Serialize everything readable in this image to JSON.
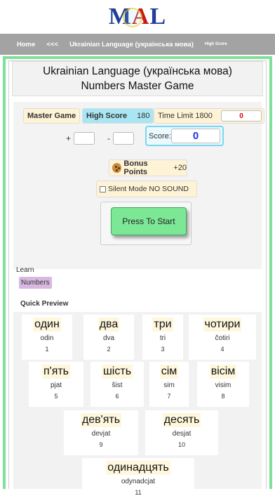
{
  "logo": {
    "m": "M",
    "a": "A",
    "l": "L"
  },
  "nav": {
    "home": "Home",
    "back": "<<<",
    "title": "Ukrainian Language (українська мова)",
    "high_score": "High Score"
  },
  "game": {
    "title_line1": "Ukrainian Language (українська мова)",
    "title_line2": "Numbers Master Game"
  },
  "controls": {
    "master_game": "Master Game",
    "high_score_label": "High Score",
    "high_score_value": "180",
    "time_limit_label": "Time Limit 1800",
    "time_value": "0",
    "plus": "+",
    "minus": "-",
    "score_label": "Score:",
    "score_value": "0",
    "bonus_label": "Bonus Points",
    "bonus_value": "+20",
    "silent_label": "Silent Mode NO SOUND",
    "start_label": "Press To Start"
  },
  "learn": {
    "label": "Learn",
    "tag": "Numbers"
  },
  "preview": {
    "label": "Quick Preview",
    "cards": [
      {
        "word": "один",
        "translit": "odin",
        "num": "1"
      },
      {
        "word": "два",
        "translit": "dva",
        "num": "2"
      },
      {
        "word": "три",
        "translit": "tri",
        "num": "3"
      },
      {
        "word": "чотири",
        "translit": "čotiri",
        "num": "4"
      },
      {
        "word": "п'ять",
        "translit": "pjat",
        "num": "5"
      },
      {
        "word": "шість",
        "translit": "šist",
        "num": "6"
      },
      {
        "word": "сім",
        "translit": "sim",
        "num": "7"
      },
      {
        "word": "вісім",
        "translit": "visim",
        "num": "8"
      },
      {
        "word": "дев'ять",
        "translit": "devjat",
        "num": "9"
      },
      {
        "word": "десять",
        "translit": "desjat",
        "num": "10"
      },
      {
        "word": "одинадцять",
        "translit": "odynadcjat",
        "num": "11"
      }
    ]
  }
}
